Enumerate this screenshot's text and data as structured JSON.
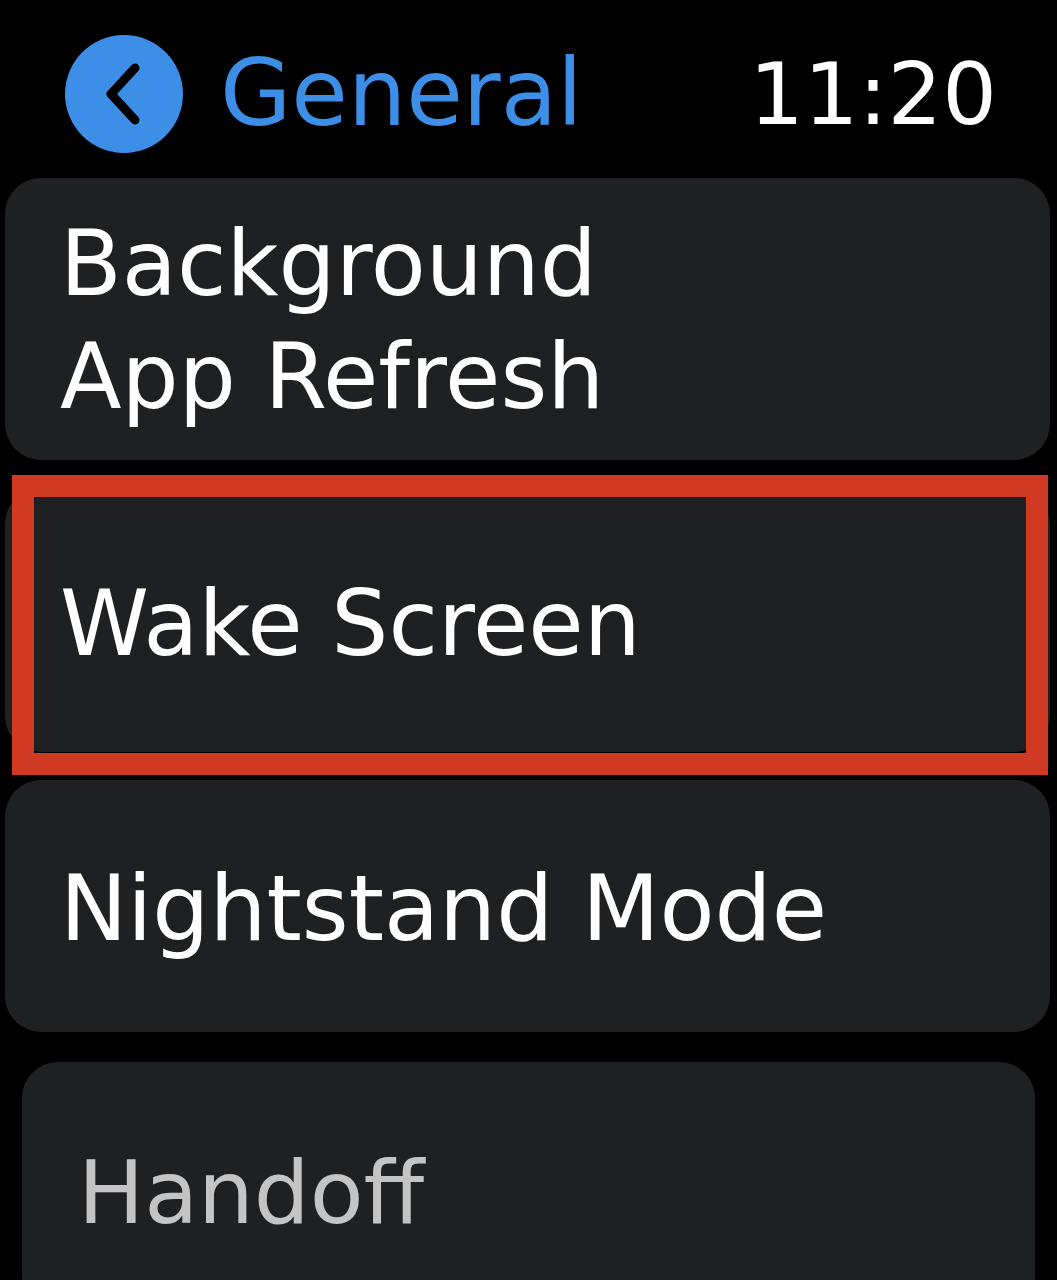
{
  "header": {
    "back_title": "General",
    "time": "11:20"
  },
  "items": [
    {
      "label": "Background App Refresh",
      "highlighted": false,
      "dimmed": false
    },
    {
      "label": "Wake Screen",
      "highlighted": true,
      "dimmed": false
    },
    {
      "label": "Nightstand Mode",
      "highlighted": false,
      "dimmed": false
    },
    {
      "label": "Handoff",
      "highlighted": false,
      "dimmed": true
    }
  ]
}
